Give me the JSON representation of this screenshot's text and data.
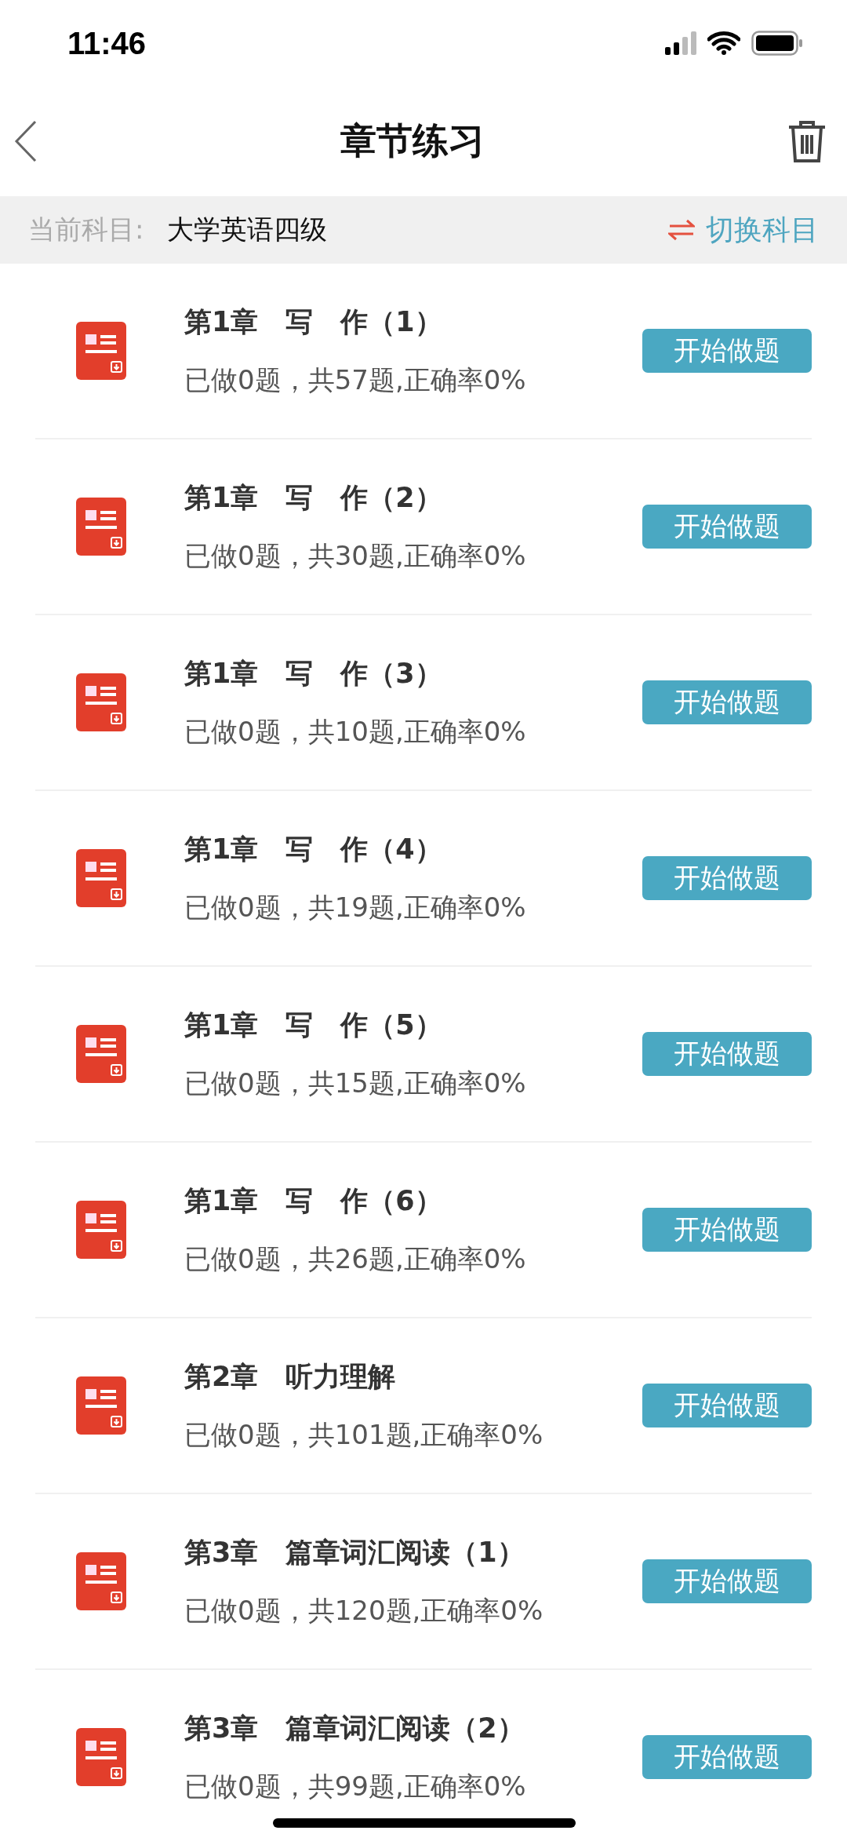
{
  "status_bar": {
    "time": "11:46"
  },
  "nav": {
    "title": "章节练习"
  },
  "subject_bar": {
    "label": "当前科目:",
    "value": "大学英语四级",
    "switch_label": "切换科目"
  },
  "chapters": [
    {
      "title": "第1章　写　作（1）",
      "progress": "已做0题，共57题,正确率0%",
      "button": "开始做题"
    },
    {
      "title": "第1章　写　作（2）",
      "progress": "已做0题，共30题,正确率0%",
      "button": "开始做题"
    },
    {
      "title": "第1章　写　作（3）",
      "progress": "已做0题，共10题,正确率0%",
      "button": "开始做题"
    },
    {
      "title": "第1章　写　作（4）",
      "progress": "已做0题，共19题,正确率0%",
      "button": "开始做题"
    },
    {
      "title": "第1章　写　作（5）",
      "progress": "已做0题，共15题,正确率0%",
      "button": "开始做题"
    },
    {
      "title": "第1章　写　作（6）",
      "progress": "已做0题，共26题,正确率0%",
      "button": "开始做题"
    },
    {
      "title": "第2章　听力理解",
      "progress": "已做0题，共101题,正确率0%",
      "button": "开始做题"
    },
    {
      "title": "第3章　篇章词汇阅读（1）",
      "progress": "已做0题，共120题,正确率0%",
      "button": "开始做题"
    },
    {
      "title": "第3章　篇章词汇阅读（2）",
      "progress": "已做0题，共99题,正确率0%",
      "button": "开始做题"
    }
  ]
}
